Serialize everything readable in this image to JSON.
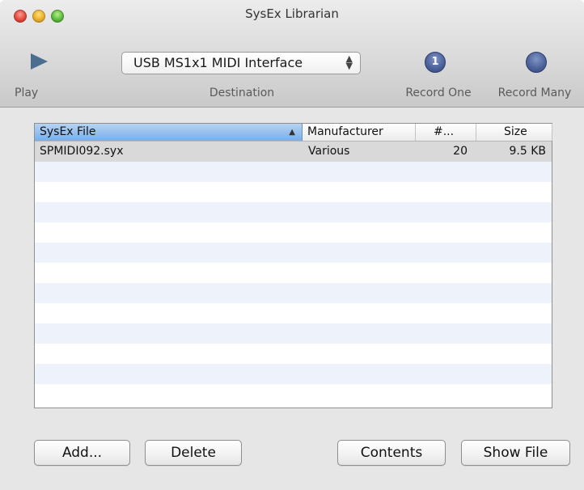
{
  "window": {
    "title": "SysEx Librarian"
  },
  "toolbar": {
    "play_label": "Play",
    "destination_label": "Destination",
    "destination_value": "USB MS1x1 MIDI Interface",
    "record_one_label": "Record One",
    "record_one_badge": "1",
    "record_many_label": "Record Many"
  },
  "table": {
    "columns": [
      "SysEx File",
      "Manufacturer",
      "#...",
      "Size"
    ],
    "sort_indicator": "▲",
    "rows": [
      {
        "file": "SPMIDI092.syx",
        "manufacturer": "Various",
        "count": "20",
        "size": "9.5 KB"
      }
    ]
  },
  "buttons": {
    "add": "Add...",
    "delete": "Delete",
    "contents": "Contents",
    "show_file": "Show File"
  },
  "colors": {
    "accent_selected_header": "#79aee8",
    "record_button": "#4b5f99",
    "play_icon": "#4b6d8e"
  }
}
